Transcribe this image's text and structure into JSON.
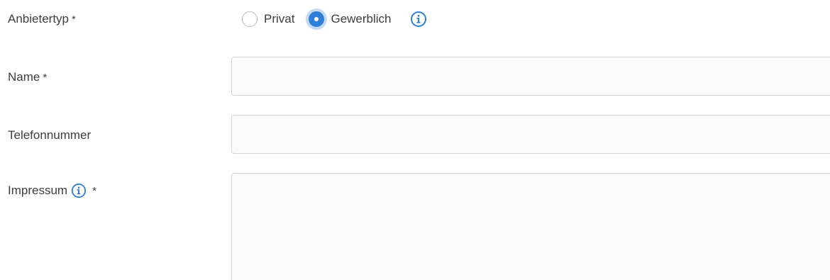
{
  "form": {
    "anbietertyp": {
      "label": "Anbietertyp",
      "required_mark": "*",
      "options": [
        {
          "label": "Privat",
          "checked": false
        },
        {
          "label": "Gewerblich",
          "checked": true
        }
      ],
      "info_icon": "info-circle-icon"
    },
    "name": {
      "label": "Name",
      "required_mark": "*",
      "value": ""
    },
    "telefonnummer": {
      "label": "Telefonnummer",
      "value": ""
    },
    "impressum": {
      "label": "Impressum",
      "required_mark": "*",
      "info_icon": "info-circle-icon",
      "value": ""
    }
  },
  "colors": {
    "accent": "#2f7fd9",
    "label_text": "#3d3d3d",
    "input_border": "#d4d4d4",
    "input_background": "#fbfbfb"
  }
}
